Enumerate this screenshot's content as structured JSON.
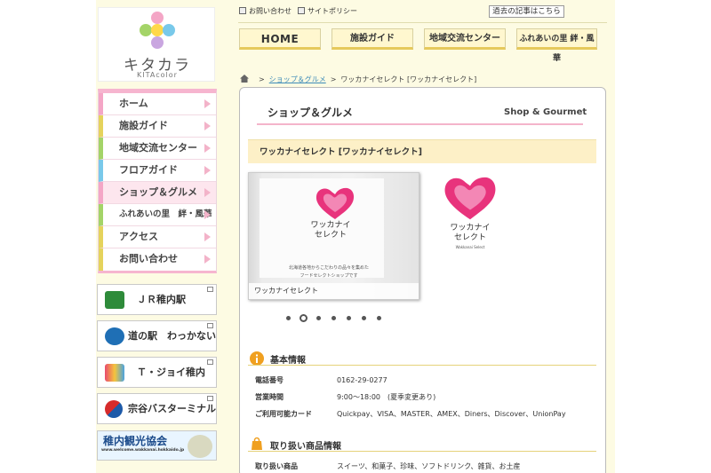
{
  "site": {
    "logo_text": "キタカラ",
    "logo_sub": "KITAcolor",
    "logo_colors": [
      "#f4a6c6",
      "#a4d468",
      "#ffd84a",
      "#79c9ea",
      "#c9a6e0"
    ]
  },
  "top_links": {
    "contact": "お問い合わせ",
    "policy": "サイトポリシー",
    "archive": "過去の記事はこちら"
  },
  "tabs": [
    "HOME",
    "施設ガイド",
    "地域交流センター",
    "ふれあいの里 絆・風華"
  ],
  "sidebar": {
    "items": [
      {
        "label": "ホーム",
        "color": "#f4a6c6"
      },
      {
        "label": "施設ガイド",
        "color": "#e5d35c"
      },
      {
        "label": "地域交流センター",
        "color": "#a4d468"
      },
      {
        "label": "フロアガイド",
        "color": "#79c9ea"
      },
      {
        "label": "ショップ＆グルメ",
        "color": "#f4a6c6"
      },
      {
        "label": "ふれあいの里　絆・風華",
        "color": "#a4d468"
      },
      {
        "label": "アクセス",
        "color": "#e5d35c"
      },
      {
        "label": "お問い合わせ",
        "color": "#e5d35c"
      }
    ],
    "banners": [
      {
        "label": "ＪＲ稚内駅"
      },
      {
        "label": "道の駅　わっかない"
      },
      {
        "label": "Ｔ・ジョイ稚内"
      },
      {
        "label": "宗谷バスターミナル"
      },
      {
        "label": "稚内観光協会",
        "sub": "www.welcome.wakkanai.hokkaido.jp"
      }
    ]
  },
  "breadcrumb": {
    "parent": "ショップ＆グルメ",
    "current": "ワッカナイセレクト [ワッカナイセレクト]"
  },
  "section": {
    "title_jp": "ショップ＆グルメ",
    "title_en": "Shop & Gourmet",
    "shop_name": "ワッカナイセレクト [ワッカナイセレクト]"
  },
  "gallery": {
    "caption": "ワッカナイセレクト",
    "sign_line1": "ワッカナイ",
    "sign_line2": "セレクト",
    "sign_sub": "北海道各地からこだわりの品々を集めた\nフードセレクトショップです",
    "logo_line1": "ワッカナイ",
    "logo_line2": "セレクト",
    "logo_sub": "Wakkanai Select",
    "dot_count": 7,
    "current_dot": 2
  },
  "basic_info": {
    "title": "基本情報",
    "rows": [
      {
        "key": "電話番号",
        "value": "0162-29-0277"
      },
      {
        "key": "営業時間",
        "value": "9:00～18:00　(夏季変更あり)"
      },
      {
        "key": "ご利用可能カード",
        "value": "Quickpay、VISA、MASTER、AMEX、Diners、Discover、UnionPay"
      }
    ]
  },
  "products": {
    "title": "取り扱い商品情報",
    "rows": [
      {
        "key": "取り扱い商品",
        "value": "スイーツ、和菓子、珍味、ソフトドリンク、雑貨、お土産"
      }
    ]
  }
}
